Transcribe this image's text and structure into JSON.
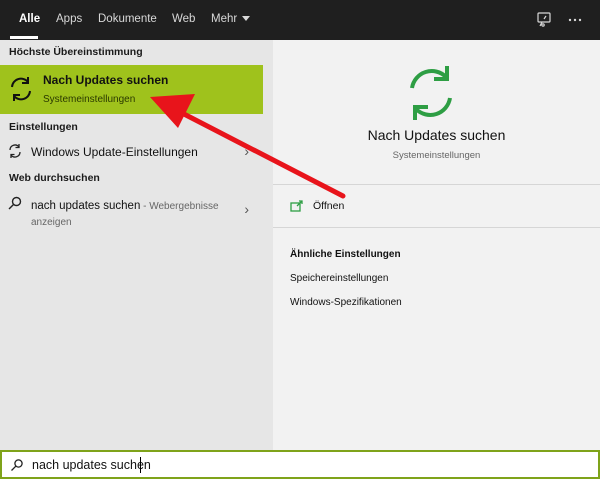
{
  "tabs": [
    "Alle",
    "Apps",
    "Dokumente",
    "Web",
    "Mehr"
  ],
  "top_icons": [
    "feedback-icon",
    "more-icon"
  ],
  "left": {
    "best_match_header": "Höchste Übereinstimmung",
    "best_match": {
      "title": "Nach Updates suchen",
      "subtitle": "Systemeinstellungen",
      "icon": "sync-icon"
    },
    "settings_header": "Einstellungen",
    "settings_item": {
      "label": "Windows Update-Einstellungen",
      "icon": "sync-icon"
    },
    "web_header": "Web durchsuchen",
    "web_item": {
      "query": "nach updates suchen",
      "suffix": " - Webergebnisse",
      "suffix2": "anzeigen",
      "icon": "search-icon"
    }
  },
  "preview": {
    "title": "Nach Updates suchen",
    "subtitle": "Systemeinstellungen",
    "action_label": "Öffnen",
    "related_header": "Ähnliche Einstellungen",
    "related": [
      "Speichereinstellungen",
      "Windows-Spezifikationen"
    ]
  },
  "search": {
    "value": "nach updates suchen"
  },
  "colors": {
    "highlight": "#9fc21c",
    "icon_green": "#2e9e44",
    "arrow_red": "#e8141b",
    "topbar": "#1f1f1f"
  }
}
